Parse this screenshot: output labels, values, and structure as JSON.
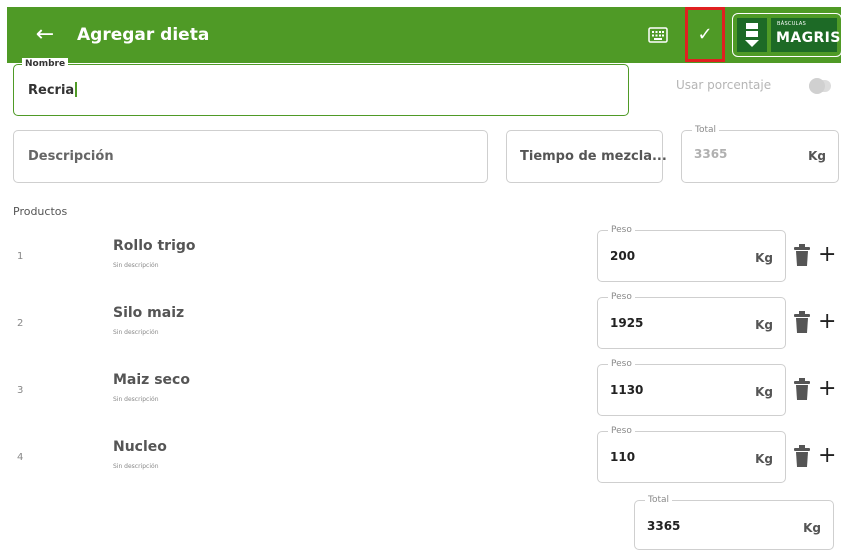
{
  "header": {
    "title": "Agregar dieta",
    "back_icon": "arrow-left-icon",
    "keyboard_icon": "keyboard-icon",
    "confirm_icon": "check-icon",
    "logo_small": "BÁSCULAS",
    "logo_main": "MAGRIS",
    "color_bar": "#4f9a26"
  },
  "form": {
    "nombre_label": "Nombre",
    "nombre_value": "Recria",
    "usar_porcentaje_label": "Usar porcentaje",
    "usar_porcentaje_on": false,
    "descripcion_placeholder": "Descripción",
    "tiempo_placeholder": "Tiempo de mezcla...",
    "total_label": "Total",
    "total_value": "3365",
    "total_unit": "Kg"
  },
  "productos": {
    "section_label": "Productos",
    "items": [
      {
        "num": "1",
        "name": "Rollo trigo",
        "desc": "Sin descripción",
        "peso_label": "Peso",
        "peso": "200",
        "unit": "Kg"
      },
      {
        "num": "2",
        "name": "Silo maiz",
        "desc": "Sin descripción",
        "peso_label": "Peso",
        "peso": "1925",
        "unit": "Kg"
      },
      {
        "num": "3",
        "name": "Maiz seco",
        "desc": "Sin descripción",
        "peso_label": "Peso",
        "peso": "1130",
        "unit": "Kg"
      },
      {
        "num": "4",
        "name": "Nucleo",
        "desc": "Sin descripción",
        "peso_label": "Peso",
        "peso": "110",
        "unit": "Kg"
      }
    ],
    "icons": {
      "delete": "trash-icon",
      "add": "plus-icon"
    }
  },
  "footer_total": {
    "label": "Total",
    "value": "3365",
    "unit": "Kg"
  }
}
